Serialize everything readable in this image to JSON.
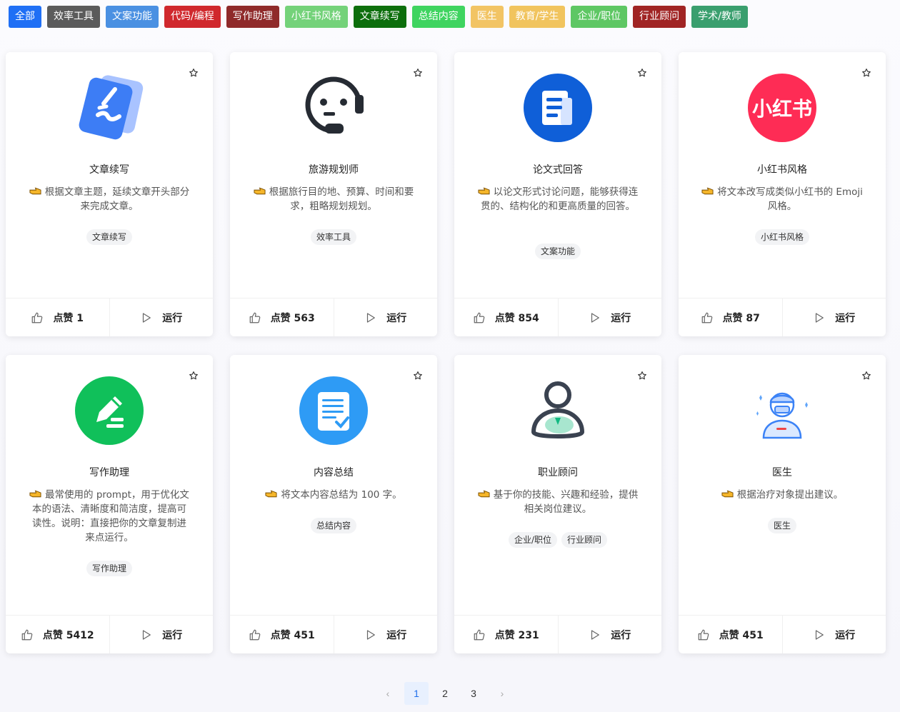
{
  "tags": [
    {
      "label": "全部",
      "color": "#1f6ff5"
    },
    {
      "label": "效率工具",
      "color": "#5b5b5b"
    },
    {
      "label": "文案功能",
      "color": "#4a90e2"
    },
    {
      "label": "代码/编程",
      "color": "#d0282d"
    },
    {
      "label": "写作助理",
      "color": "#8f2a2a"
    },
    {
      "label": "小红书风格",
      "color": "#74d27a"
    },
    {
      "label": "文章续写",
      "color": "#0c6e0c"
    },
    {
      "label": "总结内容",
      "color": "#3fd460"
    },
    {
      "label": "医生",
      "color": "#f2c464"
    },
    {
      "label": "教育/学生",
      "color": "#f1c45e"
    },
    {
      "label": "企业/职位",
      "color": "#5ec764"
    },
    {
      "label": "行业顾问",
      "color": "#a02424"
    },
    {
      "label": "学术/教师",
      "color": "#3a9f6e"
    }
  ],
  "cards": [
    {
      "icon": "pencil-card-icon",
      "title": "文章续写",
      "desc": "根据文章主题，延续文章开头部分来完成文章。",
      "chips": [
        "文章续写"
      ],
      "like_label": "点赞 1",
      "run_label": "运行"
    },
    {
      "icon": "headset-face-icon",
      "title": "旅游规划师",
      "desc": "根据旅行目的地、预算、时间和要求，粗略规划规划。",
      "chips": [
        "效率工具"
      ],
      "like_label": "点赞 563",
      "run_label": "运行"
    },
    {
      "icon": "document-icon",
      "title": "论文式回答",
      "desc": "以论文形式讨论问题，能够获得连贯的、结构化的和更高质量的回答。",
      "chips": [
        "文案功能"
      ],
      "like_label": "点赞 854",
      "run_label": "运行"
    },
    {
      "icon": "xiaohongshu-logo-icon",
      "title": "小红书风格",
      "desc": "将文本改写成类似小红书的 Emoji 风格。",
      "chips": [
        "小红书风格"
      ],
      "like_label": "点赞 87",
      "run_label": "运行",
      "logo_text": "小红书"
    },
    {
      "icon": "edit-circle-icon",
      "title": "写作助理",
      "desc": "最常使用的 prompt，用于优化文本的语法、清晰度和简洁度，提高可读性。说明：直接把你的文章复制进来点运行。",
      "chips": [
        "写作助理"
      ],
      "like_label": "点赞 5412",
      "run_label": "运行"
    },
    {
      "icon": "checklist-icon",
      "title": "内容总结",
      "desc": "将文本内容总结为 100 字。",
      "chips": [
        "总结内容"
      ],
      "like_label": "点赞 451",
      "run_label": "运行"
    },
    {
      "icon": "person-icon",
      "title": "职业顾问",
      "desc": "基于你的技能、兴趣和经验，提供相关岗位建议。",
      "chips": [
        "企业/职位",
        "行业顾问"
      ],
      "like_label": "点赞 231",
      "run_label": "运行"
    },
    {
      "icon": "doctor-icon",
      "title": "医生",
      "desc": "根据治疗对象提出建议。",
      "chips": [
        "医生"
      ],
      "like_label": "点赞 451",
      "run_label": "运行"
    }
  ],
  "pagination": {
    "prev": "‹",
    "pages": [
      "1",
      "2",
      "3"
    ],
    "current": "1",
    "next": "›"
  }
}
